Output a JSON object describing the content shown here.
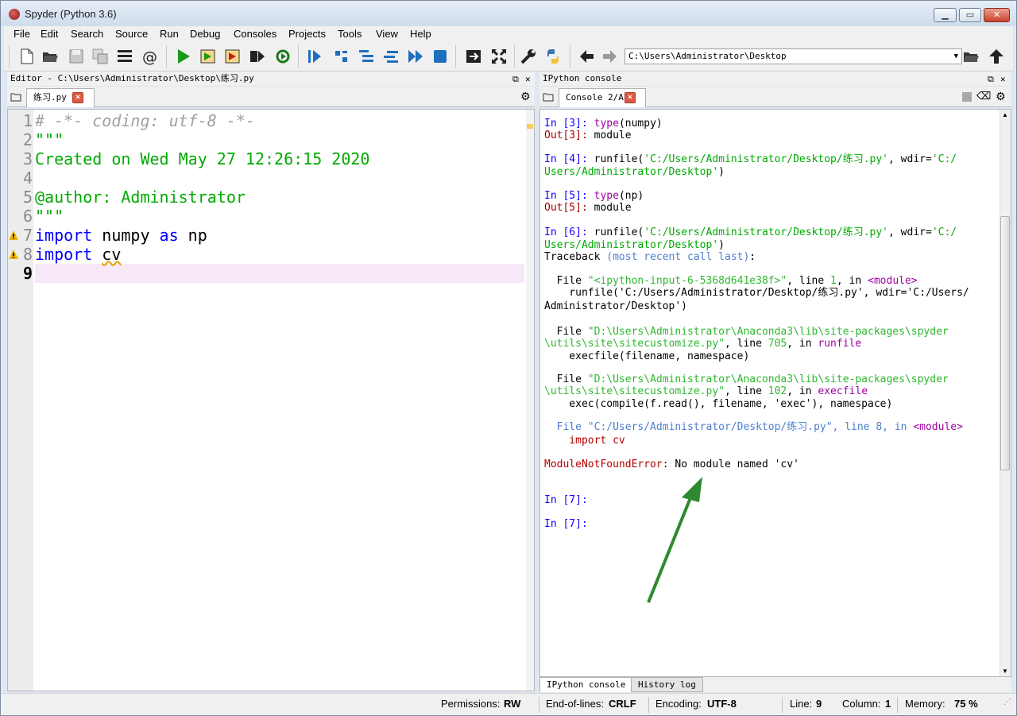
{
  "window": {
    "title": "Spyder (Python 3.6)",
    "controls": {
      "minimize": "▁",
      "maximize": "▭",
      "close": "✕"
    }
  },
  "menu": [
    "File",
    "Edit",
    "Search",
    "Source",
    "Run",
    "Debug",
    "Consoles",
    "Projects",
    "Tools",
    "View",
    "Help"
  ],
  "toolbar": {
    "path": "C:\\Users\\Administrator\\Desktop",
    "icons": [
      "new-file-icon",
      "open-folder-icon",
      "save-icon",
      "save-all-icon",
      "list-icon",
      "at-icon",
      "run-icon",
      "run-cell-icon",
      "run-cell-advance-icon",
      "run-selection-icon",
      "rerun-icon",
      "debug-icon",
      "step-icon",
      "step-into-icon",
      "step-return-icon",
      "continue-icon",
      "stop-icon",
      "maximize-pane-icon",
      "fullscreen-icon",
      "wrench-icon",
      "python-path-icon",
      "back-arrow-icon",
      "forward-arrow-icon",
      "browse-folder-icon",
      "parent-dir-icon"
    ]
  },
  "editor": {
    "title": "Editor - C:\\Users\\Administrator\\Desktop\\练习.py",
    "tab": "练习.py",
    "lines": [
      {
        "n": "1",
        "t": "# -*- coding: utf-8 -*-"
      },
      {
        "n": "2",
        "t": "\"\"\""
      },
      {
        "n": "3",
        "t": "Created on Wed May 27 12:26:15 2020"
      },
      {
        "n": "4",
        "t": ""
      },
      {
        "n": "5",
        "t": "@author: Administrator"
      },
      {
        "n": "6",
        "t": "\"\"\""
      },
      {
        "n": "7",
        "a": "import",
        "b": " numpy ",
        "c": "as",
        "d": " np"
      },
      {
        "n": "8",
        "a": "import",
        "b": " ",
        "e": "cv"
      },
      {
        "n": "9",
        "t": ""
      }
    ]
  },
  "console": {
    "title": "IPython console",
    "tab": "Console 2/A",
    "bottom_tabs": [
      "IPython console",
      "History log"
    ],
    "lines": [
      {
        "in": "In [3]: ",
        "fn": "type",
        "rest": "(numpy)"
      },
      {
        "out": "Out[3]: ",
        "rest": "module"
      },
      {
        "in": "In [4]: ",
        "rest": "runfile(",
        "s": "'C:/Users/Administrator/Desktop/练习.py'",
        "rest2": ", wdir=",
        "s2": "'C:/"
      },
      {
        "s": "Users/Administrator/Desktop'",
        "rest": ")"
      },
      {
        "in": "In [5]: ",
        "fn": "type",
        "rest": "(np)"
      },
      {
        "out": "Out[5]: ",
        "rest": "module"
      },
      {
        "in": "In [6]: ",
        "rest": "runfile(",
        "s": "'C:/Users/Administrator/Desktop/练习.py'",
        "rest2": ", wdir=",
        "s2": "'C:/"
      },
      {
        "s": "Users/Administrator/Desktop'",
        "rest": ")"
      },
      {
        "rest": "Traceback ",
        "blue": "(most recent call last)",
        "rest2": ":"
      },
      {
        "rest": "  File ",
        "g": "\"<ipython-input-6-5368d641e38f>\"",
        "rest2": ", line ",
        "num": "1",
        "rest3": ", in ",
        "pk": "<module>"
      },
      {
        "rest": "    runfile('C:/Users/Administrator/Desktop/练习.py', wdir='C:/Users/"
      },
      {
        "rest": "Administrator/Desktop')"
      },
      {
        "rest": "  File ",
        "g": "\"D:\\Users\\Administrator\\Anaconda3\\lib\\site-packages\\spyder"
      },
      {
        "g": "\\utils\\site\\sitecustomize.py\"",
        "rest": ", line ",
        "num": "705",
        "rest2": ", in ",
        "pk": "runfile"
      },
      {
        "rest": "    execfile(filename, namespace)"
      },
      {
        "rest": "  File ",
        "g": "\"D:\\Users\\Administrator\\Anaconda3\\lib\\site-packages\\spyder"
      },
      {
        "g": "\\utils\\site\\sitecustomize.py\"",
        "rest": ", line ",
        "num": "102",
        "rest2": ", in ",
        "pk": "execfile"
      },
      {
        "rest": "    exec(compile(f.read(), filename, 'exec'), namespace)"
      },
      {
        "bl": "  File \"C:/Users/Administrator/Desktop/练习.py\", line ",
        "num": "8",
        "bl2": ", in ",
        "pk": "<module>"
      },
      {
        "red": "    import cv"
      },
      {
        "red": "ModuleNotFoundError",
        "rest": ": No module named 'cv'"
      },
      {
        "in": "In [7]: "
      },
      {
        "in": "In [7]: "
      }
    ]
  },
  "status": {
    "permissions_label": "Permissions:",
    "permissions": "RW",
    "eol_label": "End-of-lines:",
    "eol": "CRLF",
    "encoding_label": "Encoding:",
    "encoding": "UTF-8",
    "line_label": "Line:",
    "line": "9",
    "column_label": "Column:",
    "column": "1",
    "memory_label": "Memory:",
    "memory": "75 %"
  },
  "colors": {
    "string": "#00aa00",
    "keyword": "#0000ff",
    "prompt_in": "#1500ff",
    "prompt_out": "#a40000",
    "error": "#b30000",
    "annotation_arrow": "#2f8a2f"
  }
}
